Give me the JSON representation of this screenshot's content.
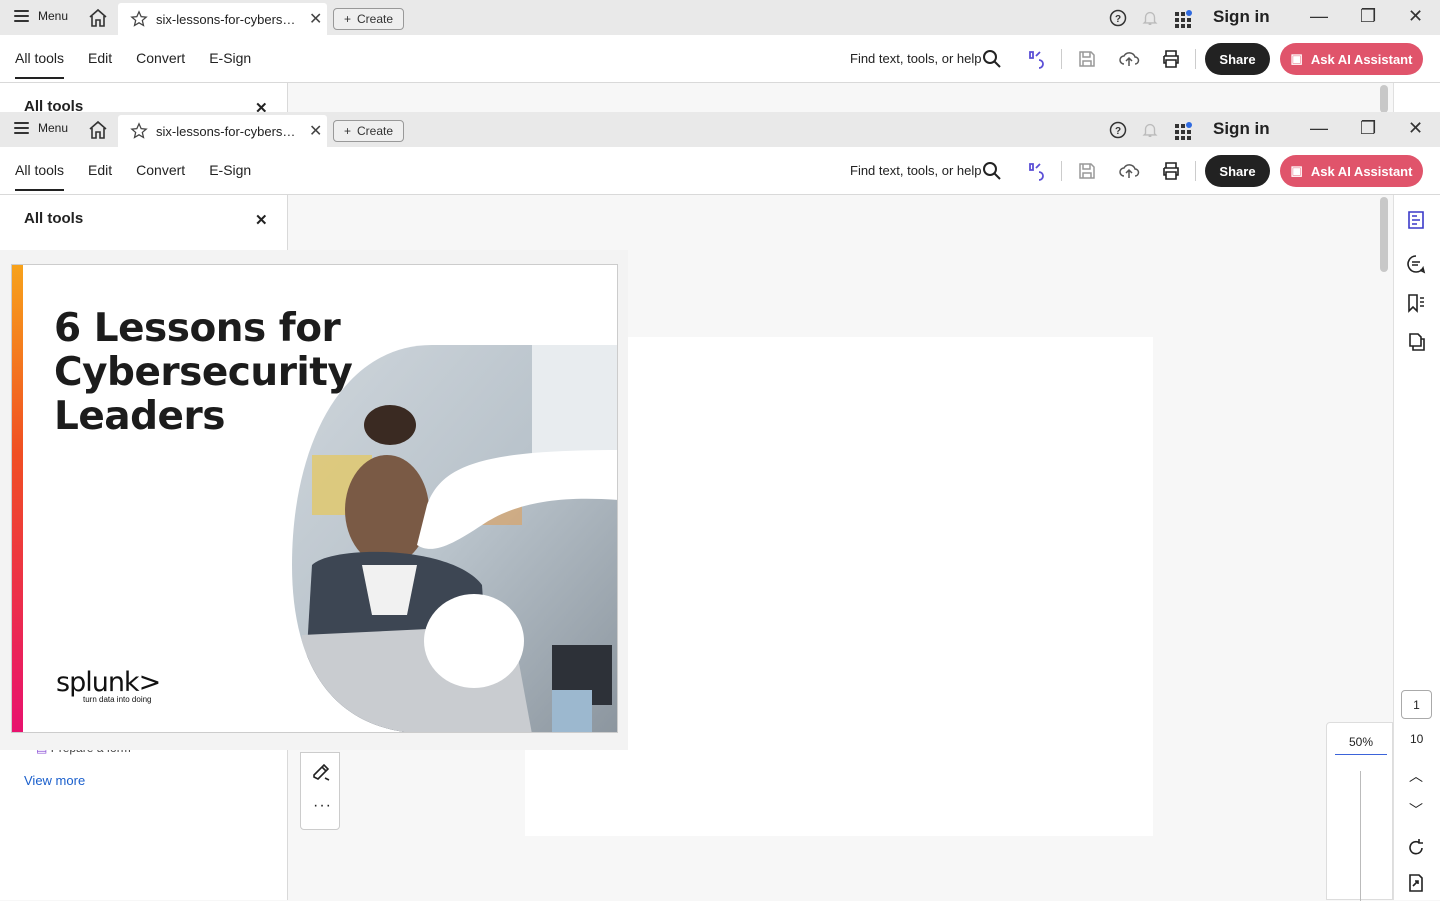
{
  "titlebar": {
    "menu_label": "Menu",
    "tab_title": "six-lessons-for-cybersecurity-leaders.pdf",
    "create_label": "Create",
    "signin_label": "Sign in"
  },
  "toolbar": {
    "nav": [
      "All tools",
      "Edit",
      "Convert",
      "E-Sign"
    ],
    "find_label": "Find text, tools, or help",
    "share_label": "Share",
    "ai_label": "Ask AI Assistant"
  },
  "sidebar": {
    "title": "All tools",
    "partial_item": "Prepare a form",
    "view_more": "View more"
  },
  "cover": {
    "title": "6 Lessons for Cybersecurity Leaders",
    "logo_word": "splunk>",
    "logo_tag": "turn data into doing"
  },
  "pager": {
    "current": "1",
    "total": "10",
    "zoom": "50%"
  },
  "colors": {
    "accent_ai": "#e0546b",
    "share_bg": "#222222",
    "link": "#1a5fcc"
  }
}
